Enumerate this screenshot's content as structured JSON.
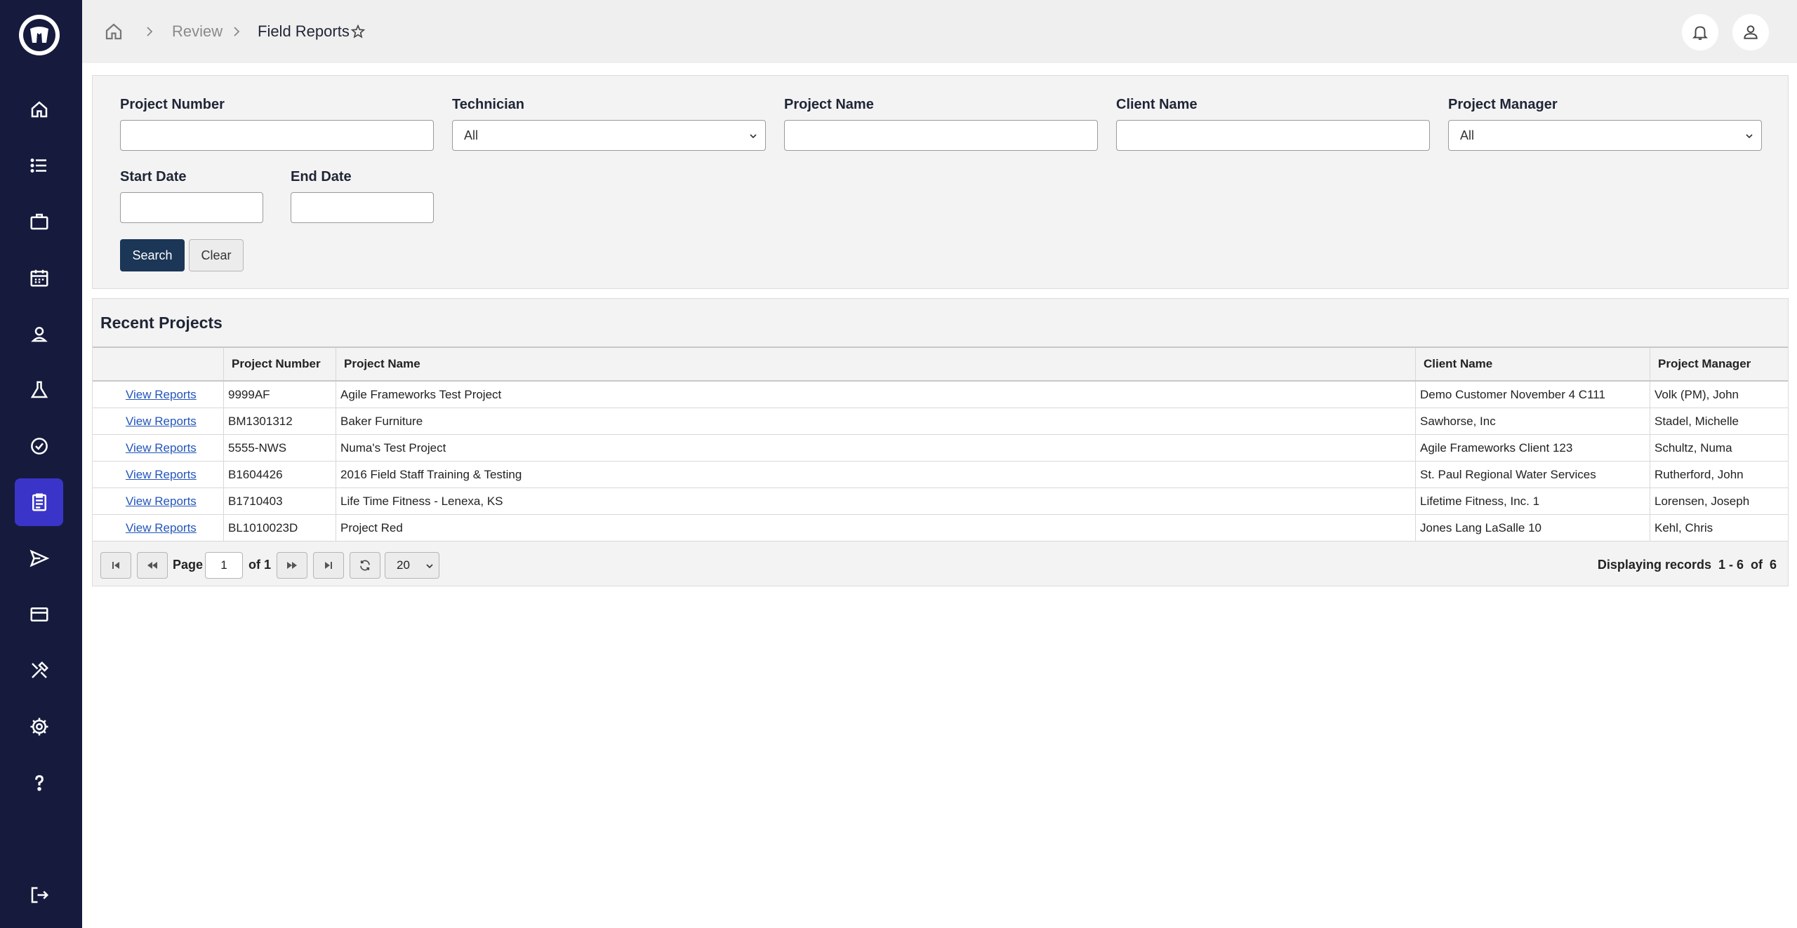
{
  "breadcrumb": {
    "review": "Review",
    "current": "Field Reports"
  },
  "sidebar": {
    "items": [
      {
        "icon": "home-icon"
      },
      {
        "icon": "list-icon"
      },
      {
        "icon": "briefcase-icon"
      },
      {
        "icon": "calendar-icon"
      },
      {
        "icon": "user-badge-icon"
      },
      {
        "icon": "flask-icon"
      },
      {
        "icon": "check-badge-icon"
      },
      {
        "icon": "clipboard-icon",
        "active": true
      },
      {
        "icon": "send-icon"
      },
      {
        "icon": "credit-card-icon"
      },
      {
        "icon": "tools-icon"
      },
      {
        "icon": "gear-icon"
      },
      {
        "icon": "help-icon"
      },
      {
        "icon": "logout-icon"
      }
    ]
  },
  "filters": {
    "project_number_label": "Project Number",
    "technician_label": "Technician",
    "technician_value": "All",
    "project_name_label": "Project Name",
    "client_name_label": "Client Name",
    "project_manager_label": "Project Manager",
    "project_manager_value": "All",
    "start_date_label": "Start Date",
    "end_date_label": "End Date",
    "search_label": "Search",
    "clear_label": "Clear"
  },
  "projects": {
    "title": "Recent Projects",
    "columns": [
      "",
      "Project Number",
      "Project Name",
      "Client Name",
      "Project Manager"
    ],
    "rows": [
      {
        "link": "View Reports",
        "number": "9999AF",
        "name": "Agile Frameworks Test Project",
        "client": "Demo Customer November 4 C111",
        "manager": "Volk (PM), John"
      },
      {
        "link": "View Reports",
        "number": "BM1301312",
        "name": "Baker Furniture",
        "client": "Sawhorse, Inc",
        "manager": "Stadel, Michelle"
      },
      {
        "link": "View Reports",
        "number": "5555-NWS",
        "name": "Numa's Test Project",
        "client": "Agile Frameworks Client 123",
        "manager": "Schultz, Numa"
      },
      {
        "link": "View Reports",
        "number": "B1604426",
        "name": "2016 Field Staff Training & Testing",
        "client": "St. Paul Regional Water Services",
        "manager": "Rutherford, John"
      },
      {
        "link": "View Reports",
        "number": "B1710403",
        "name": "Life Time Fitness - Lenexa, KS",
        "client": "Lifetime Fitness, Inc. 1",
        "manager": "Lorensen, Joseph"
      },
      {
        "link": "View Reports",
        "number": "BL1010023D",
        "name": "Project Red",
        "client": "Jones Lang LaSalle 10",
        "manager": "Kehl, Chris"
      }
    ]
  },
  "pager": {
    "page_label": "Page",
    "page_value": "1",
    "of_label": "of 1",
    "page_size": "20",
    "info": "Displaying records  1 - 6  of  6"
  },
  "colors": {
    "sidebar_bg": "#161b3d",
    "active_nav": "#3a35c8",
    "search_button": "#1b3656",
    "link": "#2255bb"
  }
}
